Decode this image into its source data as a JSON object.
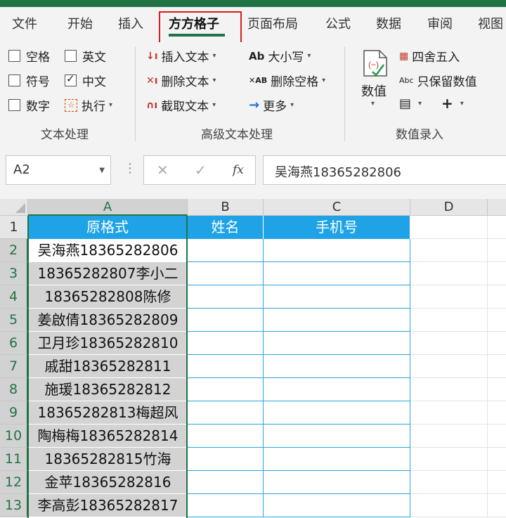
{
  "colors": {
    "excel_green": "#217346",
    "header_blue": "#1fa3e6",
    "highlight_red": "#d32020",
    "selection_gray": "#d3d3d3"
  },
  "ribbon_tabs": [
    "文件",
    "开始",
    "插入",
    "方方格子",
    "页面布局",
    "公式",
    "数据",
    "审阅",
    "视图"
  ],
  "active_tab": "方方格子",
  "text_group": {
    "options": [
      {
        "label": "空格",
        "checked": false
      },
      {
        "label": "英文",
        "checked": false
      },
      {
        "label": "符号",
        "checked": false
      },
      {
        "label": "中文",
        "checked": true
      },
      {
        "label": "数字",
        "checked": false
      }
    ],
    "execute_label": "执行",
    "group_label": "文本处理"
  },
  "advanced_group": {
    "insert_text": "插入文本",
    "delete_text": "删除文本",
    "extract_text": "截取文本",
    "case": "大小写",
    "delete_spaces": "删除空格",
    "more": "更多",
    "group_label": "高级文本处理",
    "icon_ab": "Ab",
    "icon_ab2": "AB"
  },
  "value_group": {
    "value_btn": "数值",
    "round": "四舍五入",
    "keep_values": "只保留数值",
    "icon_abc": "Abc",
    "group_label": "数值录入"
  },
  "formula_bar": {
    "name_box": "A2",
    "fx": "fx",
    "content": "吴海燕18365282806"
  },
  "sheet": {
    "columns": [
      "A",
      "B",
      "C",
      "D"
    ],
    "row_numbers": [
      "1",
      "2",
      "3",
      "4",
      "5",
      "6",
      "7",
      "8",
      "9",
      "10",
      "11",
      "12",
      "13"
    ],
    "headers": [
      "原格式",
      "姓名",
      "手机号"
    ],
    "rows": [
      "吴海燕18365282806",
      "18365282807李小二",
      "18365282808陈修",
      "姜啟倩18365282809",
      "卫月珍18365282810",
      "戚甜18365282811",
      "施瑗18365282812",
      "18365282813梅超风",
      "陶梅梅18365282814",
      "18365282815竹海",
      "金苹18365282816",
      "李高彭18365282817"
    ]
  }
}
